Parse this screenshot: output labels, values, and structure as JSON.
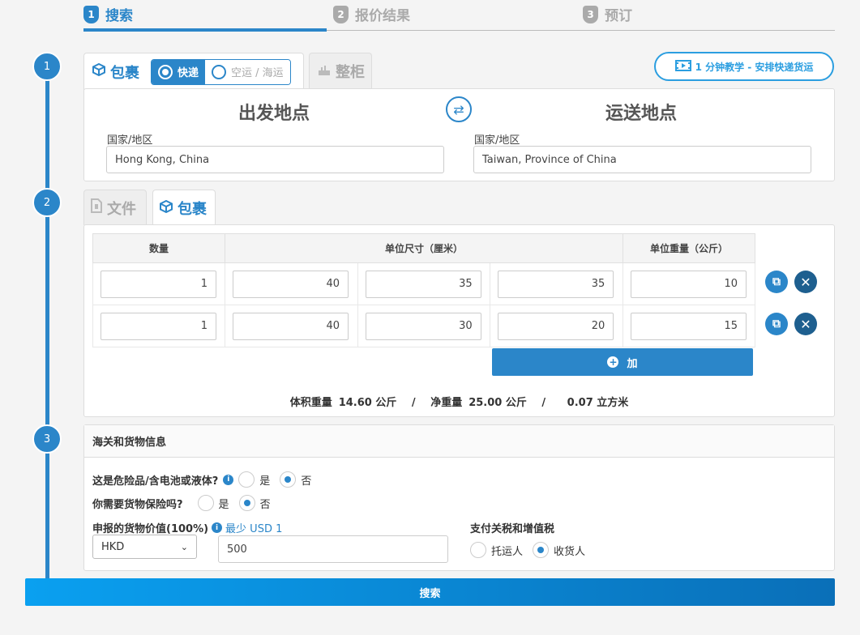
{
  "stepper": {
    "steps": [
      {
        "num": "1",
        "label": "搜索"
      },
      {
        "num": "2",
        "label": "报价结果"
      },
      {
        "num": "3",
        "label": "预订"
      }
    ]
  },
  "timeline": {
    "markers": [
      "1",
      "2",
      "3"
    ]
  },
  "shipment_type": {
    "package_tab": "包裹",
    "express_option": "快递",
    "air_sea_option": "空运 / 海运",
    "container_tab": "整柜"
  },
  "tutorial_button": "1 分钟教学 - 安排快递货运",
  "route": {
    "origin_title": "出发地点",
    "destination_title": "运送地点",
    "origin_label": "国家/地区",
    "origin_value": "Hong Kong, China",
    "destination_label": "国家/地区",
    "destination_value": "Taiwan, Province of China"
  },
  "content_tabs": {
    "document": "文件",
    "package": "包裹"
  },
  "dimensions": {
    "headers": {
      "quantity": "数量",
      "size": "单位尺寸（厘米）",
      "weight": "单位重量（公斤）"
    },
    "rows": [
      {
        "qty": "1",
        "l": "40",
        "w": "35",
        "h": "35",
        "weight": "10"
      },
      {
        "qty": "1",
        "l": "40",
        "w": "30",
        "h": "20",
        "weight": "15"
      }
    ],
    "add_label": "加"
  },
  "summary": {
    "vol_label": "体积重量",
    "vol_value": "14.60 公斤",
    "sep1": "/",
    "net_label": "净重量",
    "net_value": "25.00 公斤",
    "sep2": "/",
    "cbm": "0.07 立方米"
  },
  "customs": {
    "title": "海关和货物信息",
    "dangerous_q": "这是危险品/含电池或液体?",
    "yes": "是",
    "no": "否",
    "insurance_q": "你需要货物保险吗?",
    "declared_label": "申报的货物价值(100%)",
    "declared_min": "最少 USD 1",
    "currency": "HKD",
    "declared_value": "500",
    "duties_label": "支付关税和增值税",
    "shipper": "托运人",
    "consignee": "收货人"
  },
  "search_button": "搜索"
}
